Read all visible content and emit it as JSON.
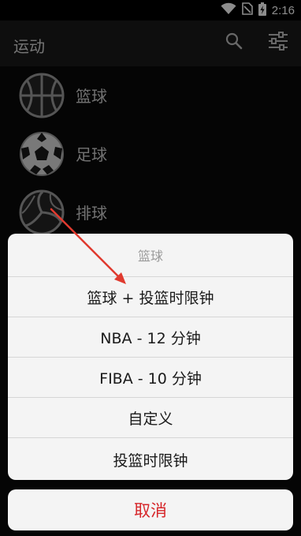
{
  "status_bar": {
    "time": "2:16"
  },
  "app_bar": {
    "title": "运动"
  },
  "sports": [
    {
      "label": "篮球",
      "icon": "basketball-icon"
    },
    {
      "label": "足球",
      "icon": "soccer-ball-icon"
    },
    {
      "label": "排球",
      "icon": "volleyball-icon"
    }
  ],
  "dialog": {
    "title": "篮球",
    "options": [
      "篮球 + 投篮时限钟",
      "NBA - 12 分钟",
      "FIBA - 10 分钟",
      "自定义",
      "投篮时限钟"
    ],
    "cancel_label": "取消"
  },
  "colors": {
    "cancel": "#d6262a",
    "annotation_arrow": "#e03a2f"
  }
}
